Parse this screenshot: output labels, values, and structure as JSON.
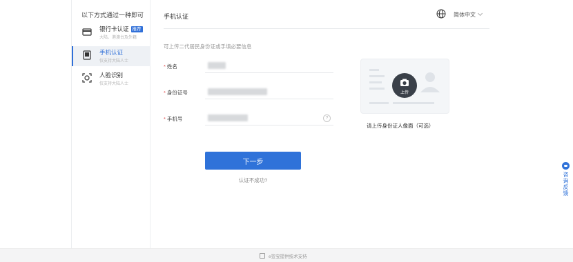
{
  "sidebar": {
    "heading": "以下方式通过一种即可",
    "items": [
      {
        "title": "银行卡认证",
        "tag": "推荐",
        "subtitle": "大陆、港澳台及外籍",
        "icon": "bank-card-icon",
        "active": false
      },
      {
        "title": "手机认证",
        "subtitle": "仅支持大陆人士",
        "icon": "phone-icon",
        "active": true
      },
      {
        "title": "人脸识别",
        "subtitle": "仅支持大陆人士",
        "icon": "face-scan-icon",
        "active": false
      }
    ]
  },
  "header": {
    "title": "手机认证",
    "language": "简体中文",
    "language_icon": "globe-icon"
  },
  "intro": "可上传二代居民身份证或手填必要信息",
  "form": {
    "required_mark": "*",
    "name_label": "姓名",
    "id_label": "身份证号",
    "phone_label": "手机号",
    "help_symbol": "?"
  },
  "actions": {
    "next_label": "下一步",
    "fail_link": "认证不成功?"
  },
  "upload": {
    "button_label": "上传",
    "caption": "请上传身份证人像面（可选）"
  },
  "feedback": {
    "label": "咨询反馈"
  },
  "footer": {
    "text": "e签宝提供技术支持"
  },
  "colors": {
    "accent": "#2f72d9",
    "required": "#e04848"
  }
}
